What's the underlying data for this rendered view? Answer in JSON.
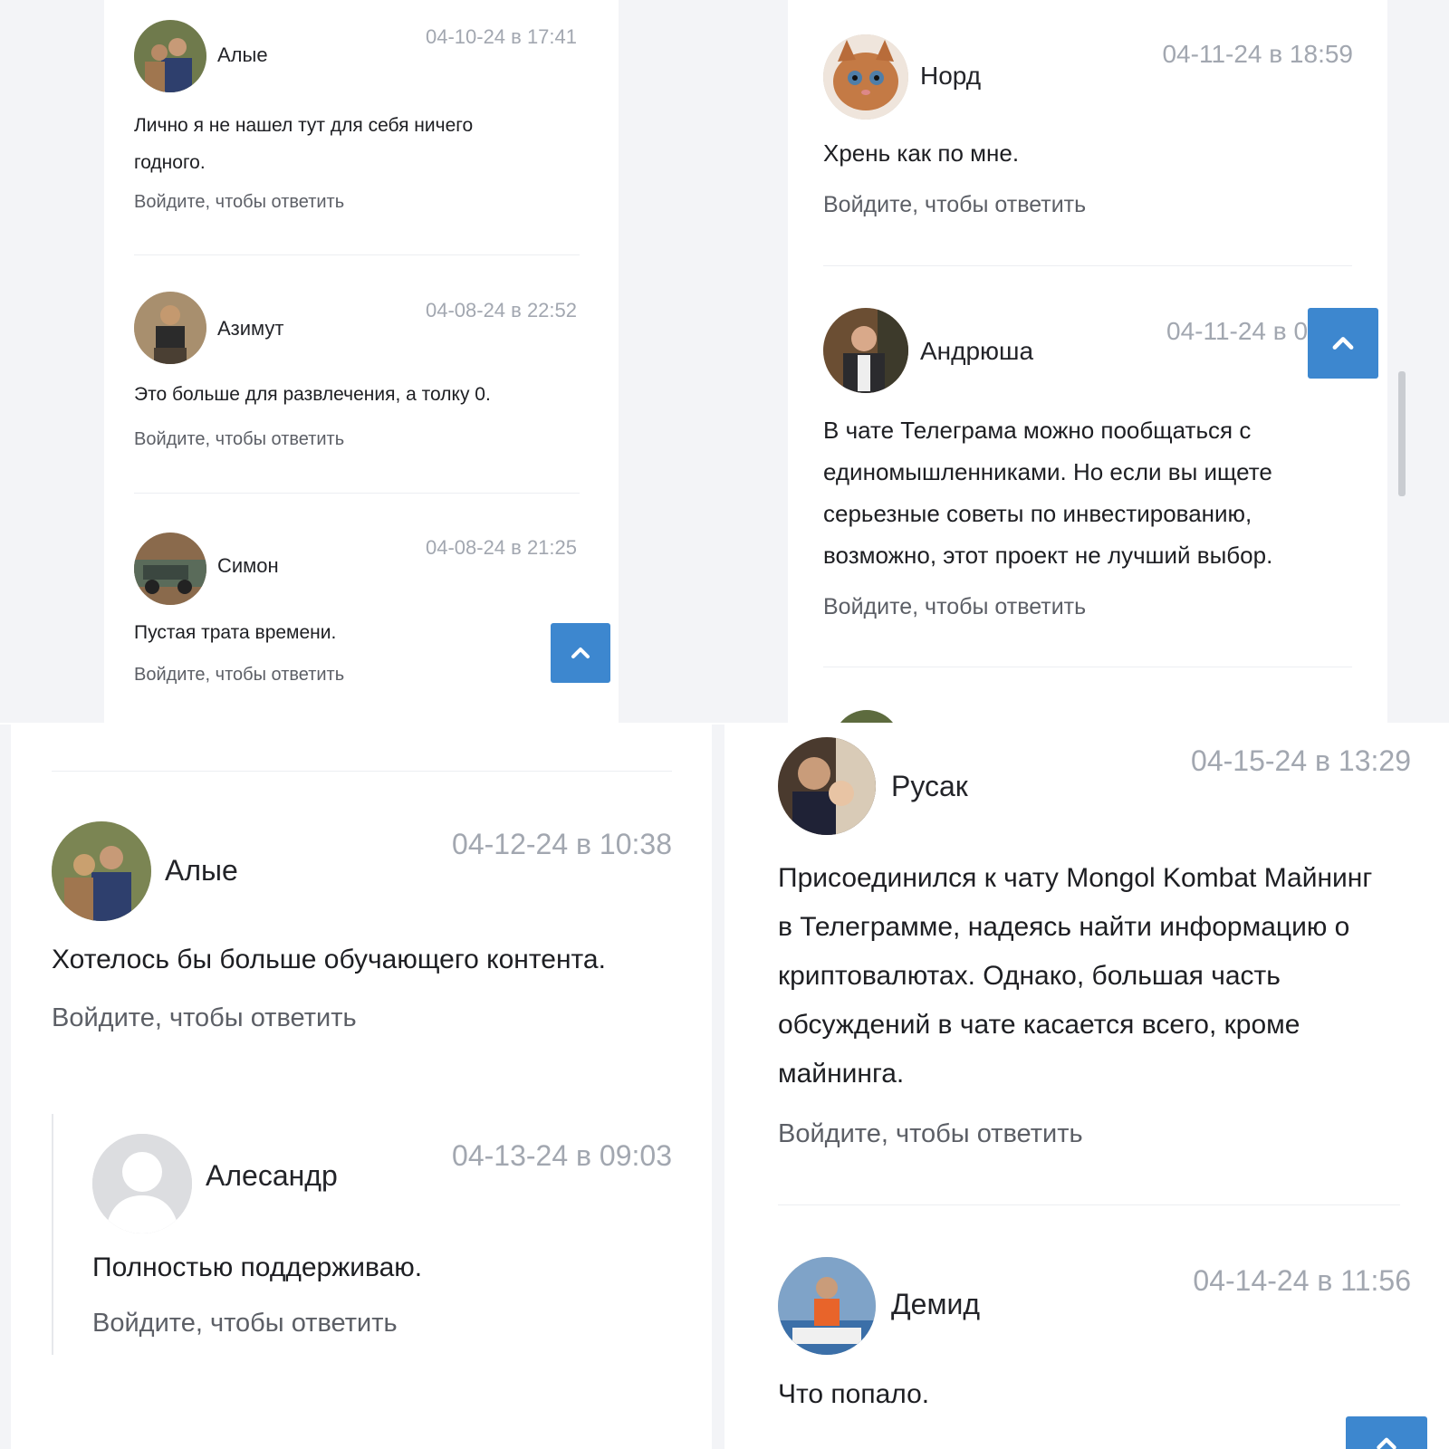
{
  "colors": {
    "accent": "#3d87cf",
    "date": "#a2a7b0",
    "text": "#1d1e22",
    "reply": "#5c5f66",
    "page_bg": "#f3f4f7"
  },
  "icons": {
    "scroll_top": "chevron-up-icon",
    "default_avatar": "user-silhouette-icon"
  },
  "reply_label": "Войдите, чтобы ответить",
  "panels": [
    {
      "comments": [
        {
          "author": "Алые",
          "date": "04-10-24 в 17:41",
          "text": "Лично я не нашел тут для себя ничего годного."
        },
        {
          "author": "Азимут",
          "date": "04-08-24 в 22:52",
          "text": "Это больше для развлечения, а толку 0."
        },
        {
          "author": "Симон",
          "date": "04-08-24 в 21:25",
          "text": "Пустая трата времени."
        }
      ]
    },
    {
      "comments": [
        {
          "author": "Норд",
          "date": "04-11-24 в 18:59",
          "text": "Хрень как по мне."
        },
        {
          "author": "Андрюша",
          "date": "04-11-24 в 0",
          "text": "В чате Телеграма можно пообщаться с единомышленниками. Но если вы ищете серьезные советы по инвестированию, возможно, этот проект не лучший выбор."
        }
      ]
    },
    {
      "comments": [
        {
          "author": "Алые",
          "date": "04-12-24 в 10:38",
          "text": "Хотелось бы больше обучающего контента."
        },
        {
          "author": "Алесандр",
          "date": "04-13-24 в 09:03",
          "text": "Полностью поддерживаю."
        }
      ]
    },
    {
      "comments": [
        {
          "author": "Русак",
          "date": "04-15-24 в 13:29",
          "text": "Присоединился к чату Mongol Kombat Майнинг в Телеграмме, надеясь найти информацию о криптовалютах. Однако, большая часть обсуждений в чате касается всего, кроме майнинга."
        },
        {
          "author": "Демид",
          "date": "04-14-24 в 11:56",
          "text": "Что попало."
        }
      ]
    }
  ]
}
